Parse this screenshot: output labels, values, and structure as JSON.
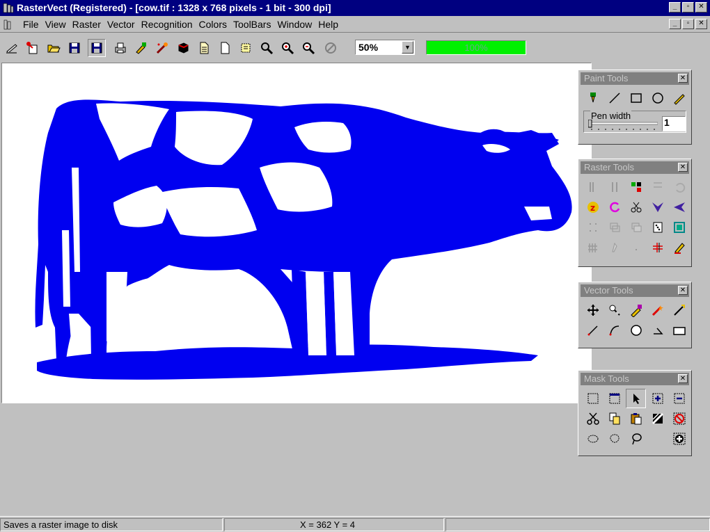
{
  "window": {
    "title": "RasterVect (Registered) - [cow.tif : 1328 x 768 pixels - 1 bit - 300 dpi]",
    "minimize": "_",
    "restore": "▫",
    "close": "✕"
  },
  "menu": {
    "items": [
      "File",
      "View",
      "Raster",
      "Vector",
      "Recognition",
      "Colors",
      "ToolBars",
      "Window",
      "Help"
    ]
  },
  "toolbar": {
    "buttons": [
      "scan-icon",
      "import-icon",
      "open-icon",
      "save-raster-icon",
      "save-vector-icon",
      "print-icon",
      "edit-icon",
      "wand-icon",
      "cube-icon",
      "new-page-icon",
      "blank-page-icon",
      "select-page-icon",
      "zoom-icon",
      "zoom-in-icon",
      "zoom-out-icon",
      "no-icon"
    ],
    "zoom_value": "50%",
    "progress_label": "100%",
    "progress_fraction": 1.0,
    "progress_color": "#00f000"
  },
  "canvas": {
    "image_color": "#0000f0"
  },
  "panels": {
    "paint": {
      "title": "Paint Tools",
      "tools": [
        "pen-icon",
        "line-icon",
        "rectangle-icon",
        "ellipse-icon",
        "pencil-icon"
      ],
      "pen_width_label": "Pen width",
      "pen_width_value": "1"
    },
    "raster": {
      "title": "Raster Tools",
      "tools": [
        "bar-h-icon",
        "bar-v-icon",
        "rotate-multi-icon",
        "split-icon",
        "undo-icon",
        "z-icon",
        "refresh-icon",
        "cut-icon",
        "v-arrow-icon",
        "triangle-arrow-icon",
        "dots-icon",
        "layers-icon",
        "layers2-icon",
        "dice-icon",
        "frame-icon",
        "fence-icon",
        "stroke-icon",
        "dot-icon",
        "grid-icon",
        "pen-red-icon"
      ]
    },
    "vector": {
      "title": "Vector Tools",
      "tools": [
        "move-icon",
        "select-node-icon",
        "edit-vector-icon",
        "explode-icon",
        "wand-vector-icon",
        "line-draw-icon",
        "arc-icon",
        "circle-icon",
        "angle-icon",
        "box-icon"
      ]
    },
    "mask": {
      "title": "Mask Tools",
      "tools": [
        "mask-rect-icon",
        "mask-window-icon",
        "mask-cursor-icon",
        "mask-plus-icon",
        "mask-minus-icon",
        "scissors-icon",
        "copy-icon",
        "paste-icon",
        "invert-icon",
        "no-entry-icon",
        "ellipse-mask-icon",
        "lasso-icon",
        "lasso2-icon",
        "",
        "compass-icon"
      ]
    }
  },
  "status": {
    "message": "Saves a raster image to disk",
    "x_label": "X = 362",
    "y_label": "Y = 4",
    "coords": "X = 362   Y = 4"
  }
}
